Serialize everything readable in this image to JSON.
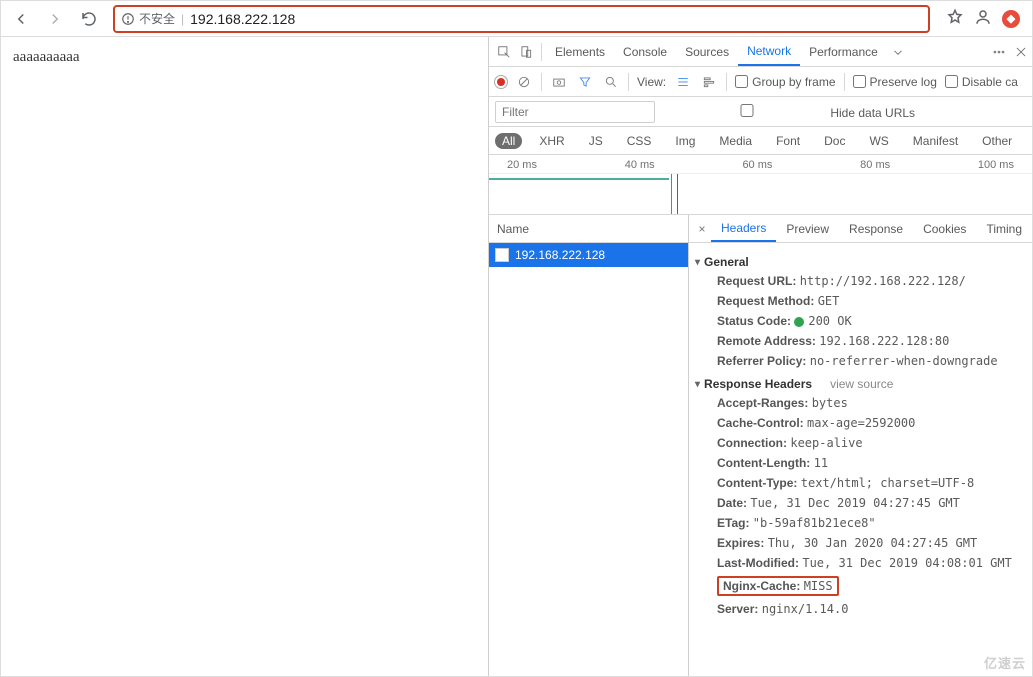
{
  "browser": {
    "insecure_label": "不安全",
    "url": "192.168.222.128"
  },
  "page": {
    "body_text": "aaaaaaaaaa"
  },
  "devtools": {
    "panels": {
      "elements": "Elements",
      "console": "Console",
      "sources": "Sources",
      "network": "Network",
      "performance": "Performance"
    },
    "toolbar": {
      "view_label": "View:",
      "group_by_frame": "Group by frame",
      "preserve_log": "Preserve log",
      "disable_cache": "Disable ca"
    },
    "filter": {
      "placeholder": "Filter",
      "hide_data_urls": "Hide data URLs"
    },
    "types": {
      "all": "All",
      "xhr": "XHR",
      "js": "JS",
      "css": "CSS",
      "img": "Img",
      "media": "Media",
      "font": "Font",
      "doc": "Doc",
      "ws": "WS",
      "manifest": "Manifest",
      "other": "Other"
    },
    "waterfall_ticks": [
      "20 ms",
      "40 ms",
      "60 ms",
      "80 ms",
      "100 ms"
    ],
    "list": {
      "col_name": "Name",
      "item0": "192.168.222.128"
    },
    "detail_tabs": {
      "headers": "Headers",
      "preview": "Preview",
      "response": "Response",
      "cookies": "Cookies",
      "timing": "Timing"
    },
    "general": {
      "title": "General",
      "request_url_k": "Request URL:",
      "request_url_v": "http://192.168.222.128/",
      "request_method_k": "Request Method:",
      "request_method_v": "GET",
      "status_code_k": "Status Code:",
      "status_code_v": "200 OK",
      "remote_addr_k": "Remote Address:",
      "remote_addr_v": "192.168.222.128:80",
      "referrer_k": "Referrer Policy:",
      "referrer_v": "no-referrer-when-downgrade"
    },
    "resp": {
      "title": "Response Headers",
      "view_source": "view source",
      "accept_ranges_k": "Accept-Ranges:",
      "accept_ranges_v": "bytes",
      "cache_control_k": "Cache-Control:",
      "cache_control_v": "max-age=2592000",
      "connection_k": "Connection:",
      "connection_v": "keep-alive",
      "content_length_k": "Content-Length:",
      "content_length_v": "11",
      "content_type_k": "Content-Type:",
      "content_type_v": "text/html; charset=UTF-8",
      "date_k": "Date:",
      "date_v": "Tue, 31 Dec 2019 04:27:45 GMT",
      "etag_k": "ETag:",
      "etag_v": "\"b-59af81b21ece8\"",
      "expires_k": "Expires:",
      "expires_v": "Thu, 30 Jan 2020 04:27:45 GMT",
      "last_mod_k": "Last-Modified:",
      "last_mod_v": "Tue, 31 Dec 2019 04:08:01 GMT",
      "nginx_cache_k": "Nginx-Cache:",
      "nginx_cache_v": "MISS",
      "server_k": "Server:",
      "server_v": "nginx/1.14.0"
    }
  },
  "watermark": "亿速云"
}
